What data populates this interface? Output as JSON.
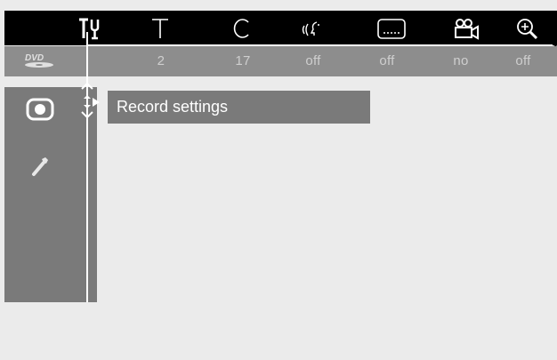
{
  "top_icons": [
    {
      "name": "settings-tools-icon"
    },
    {
      "name": "title-icon"
    },
    {
      "name": "chapter-icon"
    },
    {
      "name": "audio-icon"
    },
    {
      "name": "subtitle-icon"
    },
    {
      "name": "camera-angle-icon"
    },
    {
      "name": "zoom-icon"
    }
  ],
  "values": [
    "2",
    "17",
    "off",
    "off",
    "no",
    "off"
  ],
  "sidebar": {
    "items": [
      {
        "name": "record-icon"
      },
      {
        "name": "wrench-icon"
      }
    ]
  },
  "menu": {
    "item_label": "Record settings"
  },
  "colors": {
    "topbar": "#000000",
    "valuebar": "#8d8d8d",
    "panel": "#7a7a7a",
    "background": "#ebebeb"
  }
}
